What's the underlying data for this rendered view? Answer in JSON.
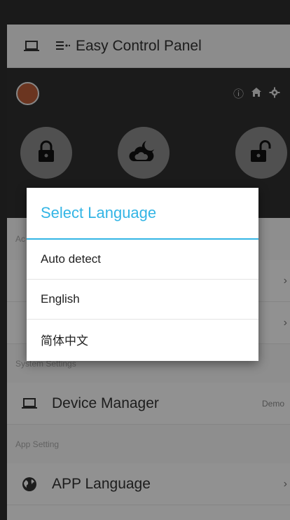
{
  "toolbar": {
    "title": "Easy Control Panel"
  },
  "header": {
    "info_glyph": "ⓘ"
  },
  "sections": {
    "partial_label": "Ac",
    "system_label": "System Settings",
    "app_label": "App Setting"
  },
  "rows": {
    "device_manager": {
      "label": "Device Manager",
      "badge": "Demo"
    },
    "app_language": {
      "label": "APP Language"
    }
  },
  "chevron": "›",
  "dialog": {
    "title": "Select Language",
    "options": [
      "Auto detect",
      "English",
      "简体中文"
    ]
  },
  "colors": {
    "accent": "#33b5e5",
    "avatar": "#b85c38"
  }
}
